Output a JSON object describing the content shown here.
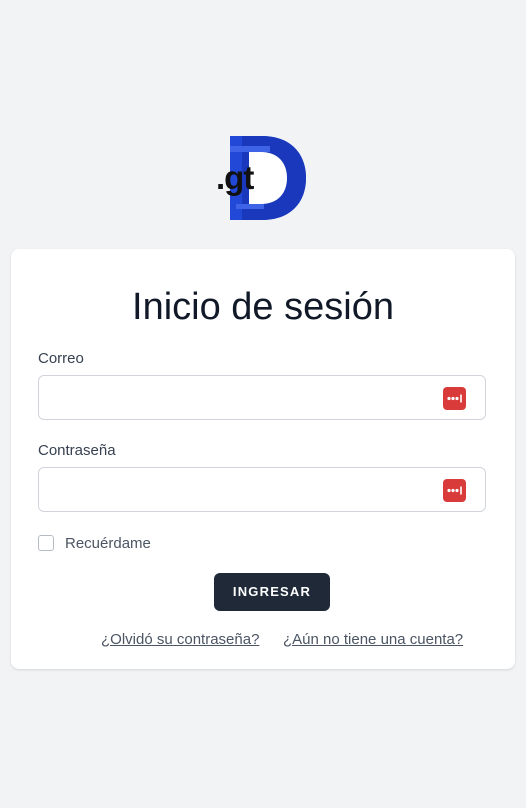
{
  "logo": {
    "text": ".gt",
    "colors": {
      "primary": "#2248d8",
      "secondary": "#1733b3",
      "text": "#111111"
    }
  },
  "form": {
    "title": "Inicio de sesión",
    "email_label": "Correo",
    "password_label": "Contraseña",
    "remember_label": "Recuérdame",
    "submit_label": "INGRESAR",
    "forgot_link": "¿Olvidó su contraseña?",
    "register_link": "¿Aún no tiene una cuenta?",
    "email_value": "",
    "password_value": "",
    "remember_checked": false,
    "field_icon": "password-manager-icon"
  },
  "colors": {
    "page_bg": "#f2f3f5",
    "card_bg": "#ffffff",
    "button_bg": "#1f2937",
    "icon_bg": "#d93a3a"
  }
}
